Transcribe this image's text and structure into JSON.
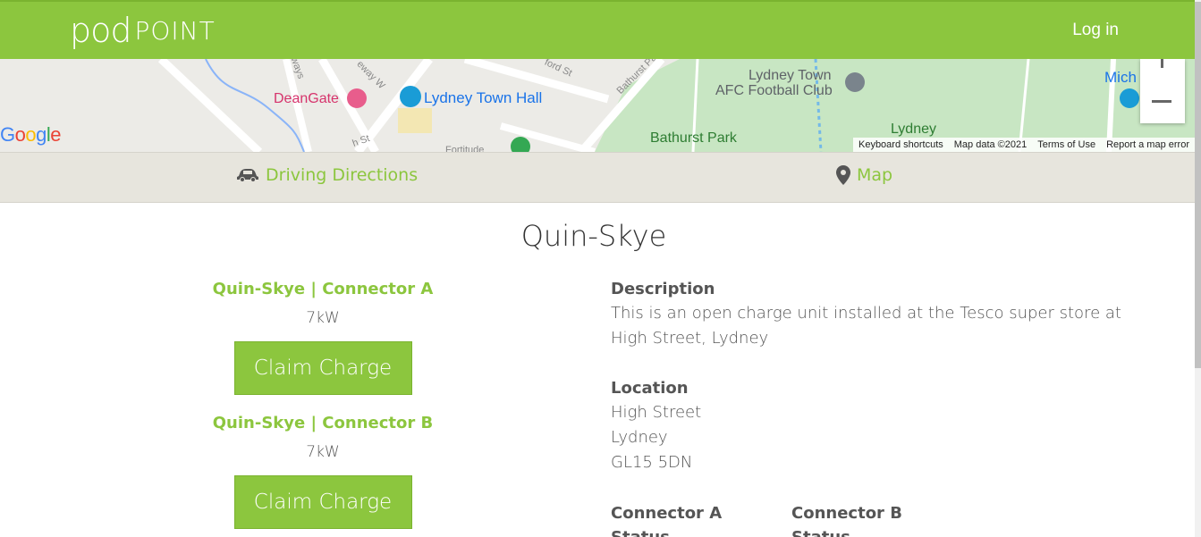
{
  "header": {
    "logo_pod": "pod",
    "logo_point": "POINT",
    "login_label": "Log in",
    "background_color": "#8cc63e"
  },
  "map": {
    "labels": {
      "deangate": "DeanGate",
      "town_hall": "Lydney Town Hall",
      "afc_line1": "Lydney Town",
      "afc_line2": "AFC Football Club",
      "bathurst_park": "Bathurst Park",
      "lydney": "Lydney",
      "mich": "Mich",
      "street_ways": "ways",
      "street_eway": "eway W",
      "street_ford": "ford St",
      "street_bathurst": "Bathurst Park",
      "street_st": "h St",
      "street_fortitude": "Fortitude"
    },
    "google_logo": "Google",
    "footer": {
      "shortcuts": "Keyboard shortcuts",
      "map_data": "Map data ©2021",
      "terms": "Terms of Use",
      "report": "Report a map error"
    }
  },
  "tabs": {
    "driving_directions": "Driving Directions",
    "map": "Map"
  },
  "page_title": "Quin-Skye",
  "connectors": [
    {
      "title": "Quin-Skye | Connector A",
      "power": "7kW",
      "button_label": "Claim Charge"
    },
    {
      "title": "Quin-Skye | Connector B",
      "power": "7kW",
      "button_label": "Claim Charge"
    }
  ],
  "description": {
    "heading": "Description",
    "text": "This is an open charge unit installed at the Tesco super store at High Street, Lydney"
  },
  "location": {
    "heading": "Location",
    "line1": "High Street",
    "line2": "Lydney",
    "line3": "GL15 5DN"
  },
  "status": {
    "connector_a_heading": "Connector A",
    "connector_a_sub": "Status",
    "connector_b_heading": "Connector B",
    "connector_b_sub": "Status"
  },
  "colors": {
    "accent": "#8cc63e",
    "tab_bar": "#e7e5dd",
    "park_green": "#c8e6c3"
  },
  "icons": {
    "car": "car-icon",
    "map_pin": "map-pin-icon"
  }
}
